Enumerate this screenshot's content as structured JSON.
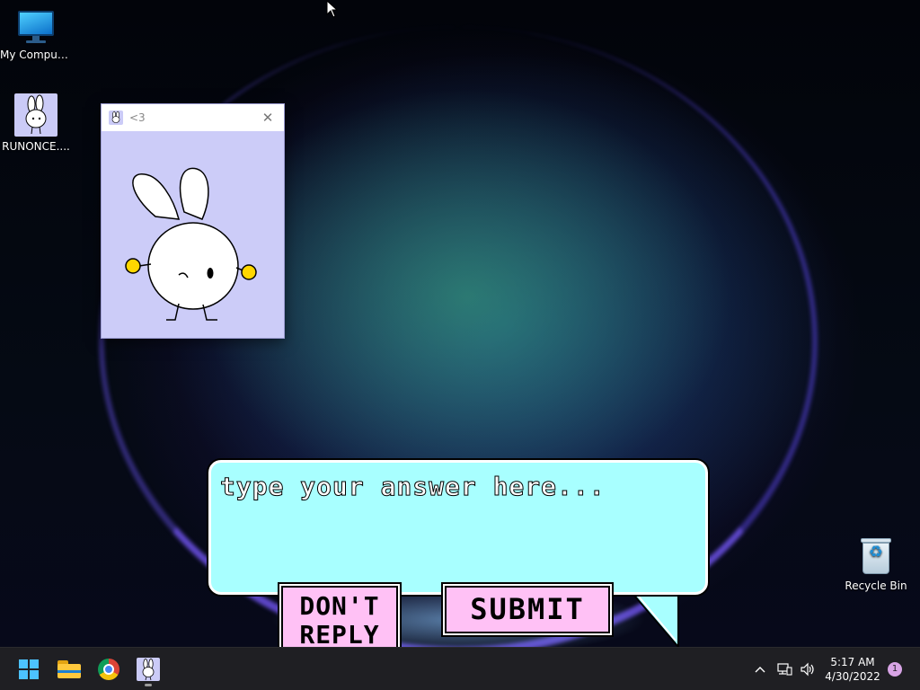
{
  "desktop": {
    "icons": [
      {
        "label": "My Computer",
        "icon": "computer-icon"
      },
      {
        "label": "RUNONCE....",
        "icon": "bunny-icon"
      },
      {
        "label": "Recycle Bin",
        "icon": "recycle-bin-icon"
      }
    ]
  },
  "bunny_window": {
    "title": "<3",
    "close_symbol": "✕",
    "icon": "bunny-icon"
  },
  "dialog": {
    "placeholder": "type your answer here...",
    "answer_value": "",
    "dont_reply_line1": "DON'T",
    "dont_reply_line2": "REPLY",
    "submit_label": "SUBMIT"
  },
  "taskbar": {
    "apps": [
      "start-icon",
      "file-explorer-icon",
      "chrome-icon",
      "bunny-icon"
    ],
    "chevron": "^",
    "time": "5:17 AM",
    "date": "4/30/2022",
    "notification_count": "1"
  },
  "colors": {
    "bubble": "#a8ffff",
    "button": "#ffc1f5",
    "bunny_bg": "#ccccf8",
    "taskbar": "#1f1f23"
  }
}
